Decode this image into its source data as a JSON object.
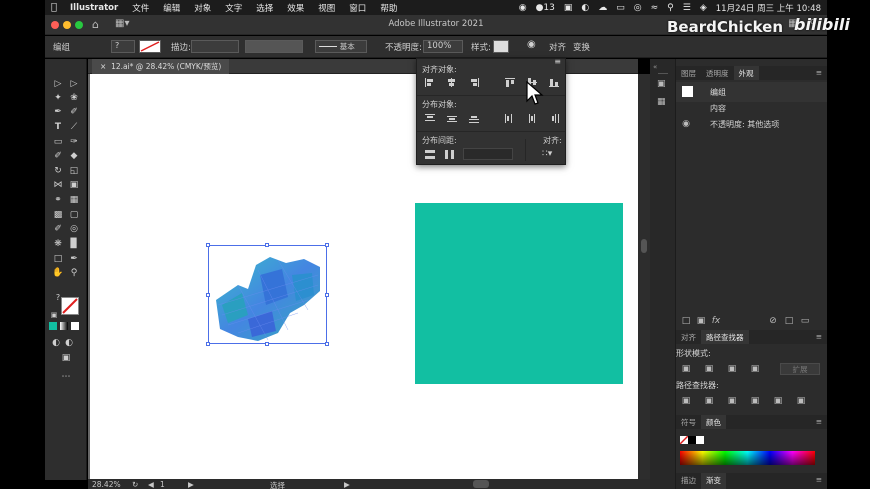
{
  "menubar": {
    "app_name": "Illustrator",
    "items": [
      "文件",
      "编辑",
      "对象",
      "文字",
      "选择",
      "效果",
      "视图",
      "窗口",
      "帮助"
    ],
    "badge": "13",
    "datetime": "11月24日 周三 上午 10:48"
  },
  "window": {
    "title": "Adobe Illustrator 2021"
  },
  "controlbar": {
    "selection_label": "编组",
    "stroke_label": "描边:",
    "stroke_style": "基本",
    "opacity_label": "不透明度:",
    "opacity_value": "100%",
    "style_label": "样式:",
    "align_label": "对齐",
    "transform_label": "变换"
  },
  "document": {
    "tab_label": "12.ai* @ 28.42% (CMYK/预览)",
    "shape_color": "#12bfa2",
    "selection_color": "#4c6fe8"
  },
  "statusbar": {
    "zoom": "28.42%",
    "artboard": "1",
    "tool": "选择"
  },
  "align_flyout": {
    "align_objects_label": "对齐对象:",
    "distribute_objects_label": "分布对象:",
    "distribute_spacing_label": "分布间距:",
    "align_to_label": "对齐:"
  },
  "appearance_panel": {
    "tabs": [
      "图层",
      "透明度",
      "外观"
    ],
    "active_tab": "外观",
    "group_label": "编组",
    "content_label": "内容",
    "opacity_row": "不透明度: 其他选项"
  },
  "pathfinder_panel": {
    "tabs": [
      "对齐",
      "路径查找器"
    ],
    "active_tab": "路径查找器",
    "shape_modes_label": "形状模式:",
    "expand_button": "扩展",
    "pathfinders_label": "路径查找器:"
  },
  "color_panel": {
    "tabs": [
      "符号",
      "颜色"
    ],
    "active_tab": "颜色"
  },
  "bottom_tabs": [
    "描边",
    "渐变"
  ],
  "watermark": {
    "author": "BeardChicken",
    "site": "bilibili"
  }
}
